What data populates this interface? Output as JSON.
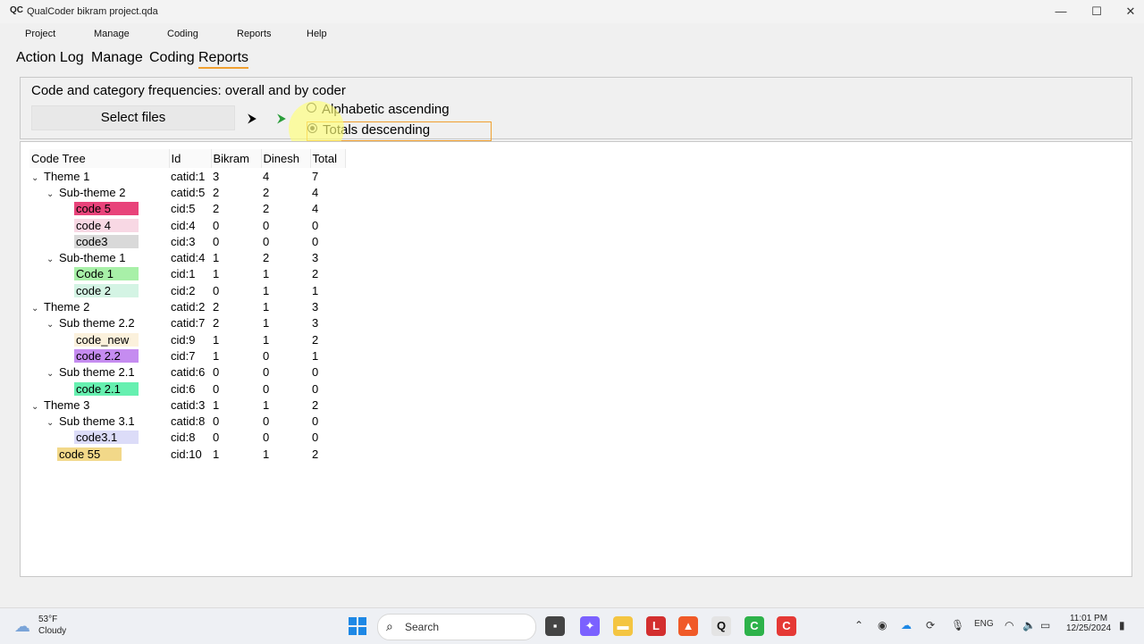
{
  "window": {
    "title": "QualCoder bikram project.qda",
    "app_icon": "QC"
  },
  "menu": [
    "Project",
    "Manage",
    "Coding",
    "Reports",
    "Help"
  ],
  "tabs": [
    "Action Log",
    "Manage",
    "Coding",
    "Reports"
  ],
  "report": {
    "title": "Code and category frequencies: overall and by coder",
    "select_files_label": "Select files",
    "sort_options": [
      "Alphabetic ascending",
      "Totals descending"
    ],
    "selected_sort": "Totals descending"
  },
  "table": {
    "headers": [
      "Code Tree",
      "Id",
      "Bikram",
      "Dinesh",
      "Total"
    ],
    "rows": [
      {
        "name": "Theme 1",
        "id": "catid:1",
        "bikram": "3",
        "dinesh": "4",
        "total": "7"
      },
      {
        "name": "Sub-theme 2",
        "id": "catid:5",
        "bikram": "2",
        "dinesh": "2",
        "total": "4"
      },
      {
        "name": "code 5",
        "id": "cid:5",
        "bikram": "2",
        "dinesh": "2",
        "total": "4",
        "color": "#e8437a"
      },
      {
        "name": "code 4",
        "id": "cid:4",
        "bikram": "0",
        "dinesh": "0",
        "total": "0",
        "color": "#f8d8e4"
      },
      {
        "name": "code3",
        "id": "cid:3",
        "bikram": "0",
        "dinesh": "0",
        "total": "0",
        "color": "#d9d9d9"
      },
      {
        "name": "Sub-theme 1",
        "id": "catid:4",
        "bikram": "1",
        "dinesh": "2",
        "total": "3"
      },
      {
        "name": "Code 1",
        "id": "cid:1",
        "bikram": "1",
        "dinesh": "1",
        "total": "2",
        "color": "#a8f0a8"
      },
      {
        "name": "code 2",
        "id": "cid:2",
        "bikram": "0",
        "dinesh": "1",
        "total": "1",
        "color": "#d4f4e4"
      },
      {
        "name": "Theme 2",
        "id": "catid:2",
        "bikram": "2",
        "dinesh": "1",
        "total": "3"
      },
      {
        "name": "Sub theme 2.2",
        "id": "catid:7",
        "bikram": "2",
        "dinesh": "1",
        "total": "3"
      },
      {
        "name": "code_new",
        "id": "cid:9",
        "bikram": "1",
        "dinesh": "1",
        "total": "2",
        "color": "#fbf1dc"
      },
      {
        "name": "code 2.2",
        "id": "cid:7",
        "bikram": "1",
        "dinesh": "0",
        "total": "1",
        "color": "#c58cf0"
      },
      {
        "name": "Sub theme 2.1",
        "id": "catid:6",
        "bikram": "0",
        "dinesh": "0",
        "total": "0"
      },
      {
        "name": "code 2.1",
        "id": "cid:6",
        "bikram": "0",
        "dinesh": "0",
        "total": "0",
        "color": "#66f0b0"
      },
      {
        "name": "Theme 3",
        "id": "catid:3",
        "bikram": "1",
        "dinesh": "1",
        "total": "2"
      },
      {
        "name": "Sub theme 3.1",
        "id": "catid:8",
        "bikram": "0",
        "dinesh": "0",
        "total": "0"
      },
      {
        "name": "code3.1",
        "id": "cid:8",
        "bikram": "0",
        "dinesh": "0",
        "total": "0",
        "color": "#dcdcf8"
      },
      {
        "name": "code 55",
        "id": "cid:10",
        "bikram": "1",
        "dinesh": "1",
        "total": "2",
        "color": "#f2d889"
      }
    ]
  },
  "taskbar": {
    "weather_temp": "53°F",
    "weather_desc": "Cloudy",
    "search_label": "Search",
    "language": "ENG",
    "time": "11:01 PM",
    "date": "12/25/2024"
  }
}
